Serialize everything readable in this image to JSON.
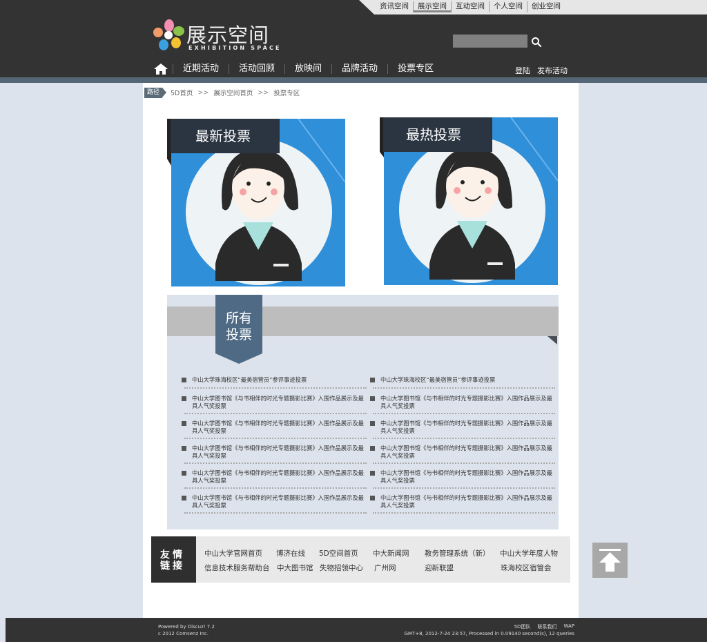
{
  "top_tabs": [
    "资讯空间",
    "展示空间",
    "互动空间",
    "个人空间",
    "创业空间"
  ],
  "logo": {
    "title": "展示空间",
    "subtitle": "EXHIBITION SPACE"
  },
  "nav": [
    "近期活动",
    "活动回顾",
    "放映间",
    "品牌活动",
    "投票专区"
  ],
  "user_links": {
    "login": "登陆",
    "publish": "发布活动"
  },
  "breadcrumb": {
    "tag": "路径",
    "items": [
      "5D首页",
      "展示空间首页",
      "投票专区"
    ],
    "sep": ">>"
  },
  "cards": {
    "latest": "最新投票",
    "hottest": "最热投票"
  },
  "all_votes": {
    "title": "所有投票",
    "left": [
      "中山大学珠海校区“最美宿管员”参评事迹投票",
      "中山大学图书馆《与书相伴的时光专题摄影比赛》入围作品展示及最具人气奖投票",
      "中山大学图书馆《与书相伴的时光专题摄影比赛》入围作品展示及最具人气奖投票",
      "中山大学图书馆《与书相伴的时光专题摄影比赛》入围作品展示及最具人气奖投票",
      "中山大学图书馆《与书相伴的时光专题摄影比赛》入围作品展示及最具人气奖投票",
      "中山大学图书馆《与书相伴的时光专题摄影比赛》入围作品展示及最具人气奖投票"
    ],
    "right": [
      "中山大学珠海校区“最美宿管员”参评事迹投票",
      "中山大学图书馆《与书相伴的时光专题摄影比赛》入围作品展示及最具人气奖投票",
      "中山大学图书馆《与书相伴的时光专题摄影比赛》入围作品展示及最具人气奖投票",
      "中山大学图书馆《与书相伴的时光专题摄影比赛》入围作品展示及最具人气奖投票",
      "中山大学图书馆《与书相伴的时光专题摄影比赛》入围作品展示及最具人气奖投票",
      "中山大学图书馆《与书相伴的时光专题摄影比赛》入围作品展示及最具人气奖投票"
    ]
  },
  "friend_links": {
    "title": "友情链接",
    "row1": [
      "中山大学官网首页",
      "博济在线",
      "5D空间首页",
      "中大新闻网",
      "教务管理系统（新）",
      "中山大学年度人物"
    ],
    "row2": [
      "信息技术服务帮助台",
      "中大图书馆",
      "失物招领中心",
      "广州网",
      "迎新联盟",
      "珠海校区宿管会"
    ]
  },
  "footer": {
    "powered": "Powered by Discuz! 7.2",
    "copyright": "c  2012 Comsenz Inc.",
    "links": [
      "5D团队",
      "联系我们",
      "WAP"
    ],
    "stats": "GMT+8,  2012-7-24 23:57,  Processed in 0.09140 second(s), 12 queries"
  },
  "colors": {
    "header": "#333333",
    "accent_blue": "#2f8fd9",
    "tag_blue": "#4f6a84"
  }
}
